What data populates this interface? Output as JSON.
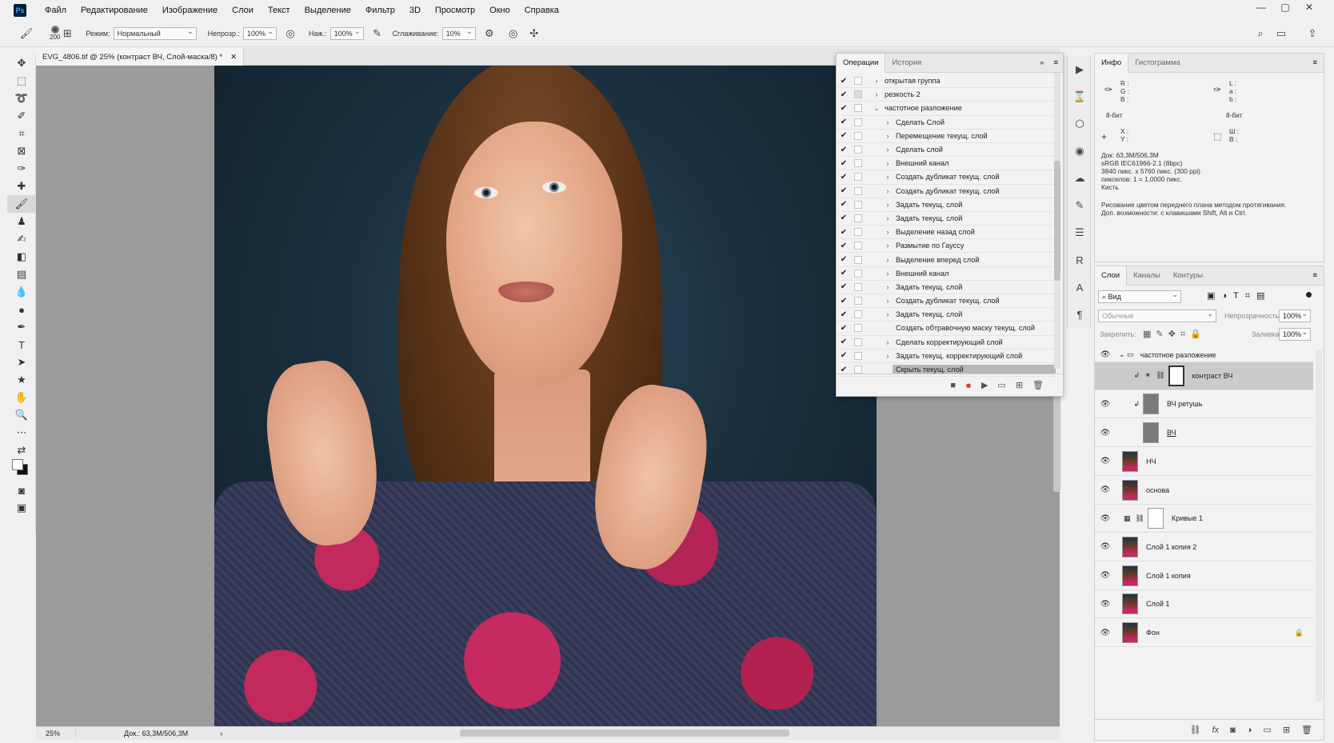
{
  "app": {
    "logo": "Ps"
  },
  "menu": [
    "Файл",
    "Редактирование",
    "Изображение",
    "Слои",
    "Текст",
    "Выделение",
    "Фильтр",
    "3D",
    "Просмотр",
    "Окно",
    "Справка"
  ],
  "window_controls": {
    "minimize": "—",
    "maximize": "▢",
    "close": "✕"
  },
  "options": {
    "brush_size": "200",
    "mode_label": "Режим:",
    "mode_value": "Нормальный",
    "opacity_label": "Непрозр.:",
    "opacity_value": "100%",
    "flow_label": "Наж.:",
    "flow_value": "100%",
    "smoothing_label": "Сглаживание:",
    "smoothing_value": "10%"
  },
  "document": {
    "tab_title": "EVG_4806.tif @ 25% (контраст ВЧ, Слой-маска/8) *",
    "zoom": "25%",
    "doc_size": "Док.: 63,3M/506,3M"
  },
  "actions_panel": {
    "tabs": [
      "Операции",
      "История"
    ],
    "rows": [
      {
        "label": "открытая группа",
        "indent": 0,
        "expand": "›",
        "dialog": false
      },
      {
        "label": "резкость 2",
        "indent": 0,
        "expand": "›",
        "dialog": true
      },
      {
        "label": "частотное разложение",
        "indent": 0,
        "expand": "⌄",
        "dialog": false
      },
      {
        "label": "Сделать Слой",
        "indent": 1,
        "expand": "›",
        "dialog": false
      },
      {
        "label": "Перемещение текущ. слой",
        "indent": 1,
        "expand": "›",
        "dialog": false
      },
      {
        "label": "Сделать слой",
        "indent": 1,
        "expand": "›",
        "dialog": false
      },
      {
        "label": "Внешний канал",
        "indent": 1,
        "expand": "›",
        "dialog": false
      },
      {
        "label": "Создать дубликат текущ. слой",
        "indent": 1,
        "expand": "›",
        "dialog": false
      },
      {
        "label": "Создать дубликат текущ. слой",
        "indent": 1,
        "expand": "›",
        "dialog": false
      },
      {
        "label": "Задать текущ. слой",
        "indent": 1,
        "expand": "›",
        "dialog": false
      },
      {
        "label": "Задать текущ. слой",
        "indent": 1,
        "expand": "›",
        "dialog": false
      },
      {
        "label": "Выделение назад слой",
        "indent": 1,
        "expand": "›",
        "dialog": false
      },
      {
        "label": "Размытие по Гауссу",
        "indent": 1,
        "expand": "›",
        "dialog": false
      },
      {
        "label": "Выделение вперед слой",
        "indent": 1,
        "expand": "›",
        "dialog": false
      },
      {
        "label": "Внешний канал",
        "indent": 1,
        "expand": "›",
        "dialog": false
      },
      {
        "label": "Задать текущ. слой",
        "indent": 1,
        "expand": "›",
        "dialog": false
      },
      {
        "label": "Создать дубликат текущ. слой",
        "indent": 1,
        "expand": "›",
        "dialog": false
      },
      {
        "label": "Задать текущ. слой",
        "indent": 1,
        "expand": "›",
        "dialog": false
      },
      {
        "label": "Создать обтравочную маску текущ. слой",
        "indent": 1,
        "expand": "",
        "dialog": false
      },
      {
        "label": "Сделать корректирующий слой",
        "indent": 1,
        "expand": "›",
        "dialog": false
      },
      {
        "label": "Задать текущ. корректирующий слой",
        "indent": 1,
        "expand": "›",
        "dialog": false
      },
      {
        "label": "Скрыть текущ. слой",
        "indent": 1,
        "expand": "",
        "dialog": false
      }
    ]
  },
  "info_panel": {
    "tabs": [
      "Инфо",
      "Гистограмма"
    ],
    "r": "R :",
    "g": "G :",
    "b": "B :",
    "l": "L :",
    "a": "a :",
    "b2": "b :",
    "bit1": "8-бит",
    "bit2": "8-бит",
    "x": "X :",
    "y": "Y :",
    "w": "Ш :",
    "h": "В :",
    "doc": "Док: 63,3M/506,3M",
    "profile": "sRGB IEC61966-2.1 (8bpc)",
    "dims": "3840 пикс. x 5760 пикс. (300 ppi)",
    "pixels": "пикселов: 1 = 1,0000 пикс.",
    "tool": "Кисть",
    "hint1": "Рисование цветом переднего плана методом протягивания.",
    "hint2": "Доп. возможности: с клавишами Shift, Alt и Ctrl."
  },
  "layers_panel": {
    "tabs": [
      "Слои",
      "Каналы",
      "Контуры"
    ],
    "filter": "Вид",
    "blend": "Обычные",
    "opacity_label": "Непрозрачность:",
    "opacity_value": "100%",
    "lock_label": "Закрепить:",
    "fill_label": "Заливка:",
    "fill_value": "100%",
    "layers": [
      {
        "name": "частотное разложение",
        "type": "group"
      },
      {
        "name": "контраст ВЧ",
        "type": "adjust-mask"
      },
      {
        "name": "ВЧ ретушь",
        "type": "gray-clip"
      },
      {
        "name": "ВЧ",
        "type": "gray"
      },
      {
        "name": "НЧ",
        "type": "photo"
      },
      {
        "name": "основа",
        "type": "photo"
      },
      {
        "name": "Кривые 1",
        "type": "curves"
      },
      {
        "name": "Слой 1 копия 2",
        "type": "photo"
      },
      {
        "name": "Слой 1 копия",
        "type": "photo"
      },
      {
        "name": "Слой 1",
        "type": "photo"
      },
      {
        "name": "Фон",
        "type": "photo-locked"
      }
    ]
  },
  "colors": {
    "accent_record": "#e23c32",
    "selected_row": "#cbcbcb"
  }
}
